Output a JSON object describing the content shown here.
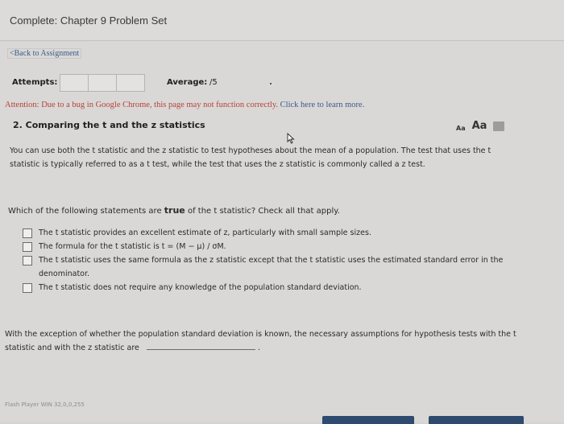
{
  "window": {
    "title": "Complete: Chapter 9 Problem Set"
  },
  "nav": {
    "back_label": "<Back to Assignment"
  },
  "attempts": {
    "label": "Attempts:",
    "average_label": "Average:",
    "average_value": "/5"
  },
  "notice": {
    "text": "Attention: Due to a bug in Google Chrome, this page may not function correctly.",
    "link": "Click here to learn more."
  },
  "question": {
    "title": "2. Comparing the t and the z statistics",
    "intro": "You can use both the t statistic and the z statistic to test hypotheses about the mean of a population. The test that uses the t statistic is typically referred to as a t test, while the test that uses the z statistic is commonly called a z test.",
    "prompt_before": "Which of the following statements are",
    "prompt_emphasis": "true",
    "prompt_after": "of the t statistic? Check all that apply.",
    "options": [
      "The t statistic provides an excellent estimate of z, particularly with small sample sizes.",
      "The formula for the t statistic is t = (M − μ) / σM.",
      "The t statistic uses the same formula as the z statistic except that the t statistic uses the estimated standard error in the denominator.",
      "The t statistic does not require any knowledge of the population standard deviation."
    ],
    "completion_text": "With the exception of whether the population standard deviation is known, the necessary assumptions for hypothesis tests with the t statistic and with the z statistic are",
    "completion_end": "."
  },
  "toolbar": {
    "font_small": "Aa",
    "font_large": "Aa"
  },
  "footer": {
    "player_version": "Flash Player WIN 32,0,0,255"
  },
  "icons": {
    "print": "print-icon",
    "cursor": "cursor-icon"
  }
}
